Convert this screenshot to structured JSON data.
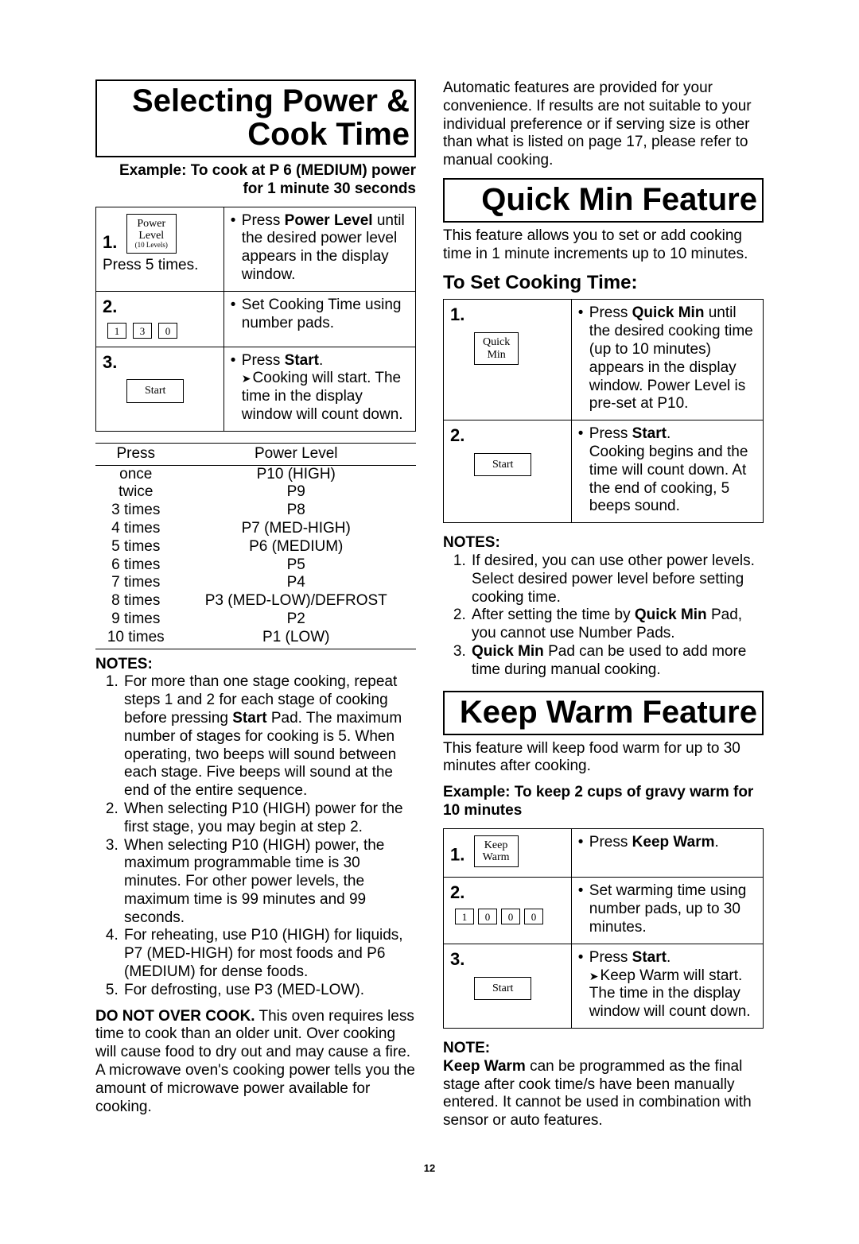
{
  "page_number": "12",
  "left": {
    "heading": "Selecting Power & Cook Time",
    "example_header": "Example: To cook at P 6 (MEDIUM) power for 1 minute 30 seconds",
    "steps": [
      {
        "num": "1.",
        "btn": {
          "l1": "Power",
          "l2": "Level",
          "l3": "(10 Levels)"
        },
        "caption": "Press 5 times.",
        "desc_pre": "Press ",
        "desc_bold": "Power Level",
        "desc_post": " until the desired power level appears in the display window."
      },
      {
        "num": "2.",
        "pads": [
          "1",
          "3",
          "0"
        ],
        "desc": "Set Cooking Time using number pads."
      },
      {
        "num": "3.",
        "btn": {
          "l1": "Start"
        },
        "desc_pre": "Press ",
        "desc_bold": "Start",
        "desc_post": ".",
        "arrow_text": "Cooking will start. The time in the display window will count down."
      }
    ],
    "power_table": {
      "headers": [
        "Press",
        "Power Level"
      ],
      "rows": [
        [
          "once",
          "P10 (HIGH)"
        ],
        [
          "twice",
          "P9"
        ],
        [
          "3 times",
          "P8"
        ],
        [
          "4 times",
          "P7 (MED-HIGH)"
        ],
        [
          "5 times",
          "P6 (MEDIUM)"
        ],
        [
          "6 times",
          "P5"
        ],
        [
          "7 times",
          "P4"
        ],
        [
          "8 times",
          "P3 (MED-LOW)/DEFROST"
        ],
        [
          "9 times",
          "P2"
        ],
        [
          "10 times",
          "P1 (LOW)"
        ]
      ]
    },
    "notes_label": "NOTES:",
    "notes": [
      "For more than one stage cooking, repeat steps 1 and 2 for each stage of cooking before pressing <b>Start</b> Pad. The maximum number of stages for cooking is 5. When operating, two beeps will sound between each stage. Five beeps will sound at the end of the entire sequence.",
      "When selecting P10 (HIGH) power for the first stage, you may begin at step 2.",
      "When selecting P10 (HIGH) power, the maximum programmable time is 30 minutes. For other power levels, the maximum time is 99 minutes and 99 seconds.",
      "For reheating, use P10 (HIGH) for liquids, P7 (MED-HIGH) for most foods and P6 (MEDIUM) for dense foods.",
      "For defrosting, use P3 (MED-LOW)."
    ],
    "warning": "<b>DO NOT OVER COOK.</b> This oven requires less time to cook than an older unit. Over cooking will cause food to dry out and may cause a fire. A microwave oven's cooking power tells you the amount of microwave power available for cooking."
  },
  "right": {
    "intro": "Automatic features are provided for your convenience. If results are not suitable to your individual preference or if serving size is other than what is listed on page 17, please refer to manual cooking.",
    "quick_heading": "Quick Min Feature",
    "quick_intro": "This feature allows you to set or add cooking time in 1 minute increments up to 10 minutes.",
    "set_cook_heading": "To Set Cooking Time:",
    "quick_steps": [
      {
        "num": "1.",
        "btn": {
          "l1": "Quick",
          "l2": "Min"
        },
        "desc_pre": "Press ",
        "desc_bold": "Quick Min",
        "desc_post": " until the desired cooking time (up to 10 minutes) appears in the display window. Power Level is pre-set at P10."
      },
      {
        "num": "2.",
        "btn": {
          "l1": "Start"
        },
        "desc_pre": "Press ",
        "desc_bold": "Start",
        "desc_post": ".",
        "extra": "Cooking begins and the time will count down. At the end of cooking, 5 beeps sound."
      }
    ],
    "quick_notes_label": "NOTES:",
    "quick_notes": [
      "If desired, you can use other power levels. Select desired power level before setting cooking time.",
      "After setting the time by <b>Quick Min</b> Pad, you cannot use Number Pads.",
      "<b>Quick Min</b> Pad can be used to add more time during manual cooking."
    ],
    "warm_heading": "Keep Warm Feature",
    "warm_intro": "This feature will keep food warm for up to 30 minutes after cooking.",
    "warm_example": "Example: To keep 2 cups of gravy warm for 10 minutes",
    "warm_steps": [
      {
        "num": "1.",
        "btn": {
          "l1": "Keep",
          "l2": "Warm"
        },
        "desc_pre": "Press ",
        "desc_bold": "Keep Warm",
        "desc_post": "."
      },
      {
        "num": "2.",
        "pads": [
          "1",
          "0",
          "0",
          "0"
        ],
        "desc": "Set warming time using number pads, up to 30 minutes."
      },
      {
        "num": "3.",
        "btn": {
          "l1": "Start"
        },
        "desc_pre": "Press ",
        "desc_bold": "Start",
        "desc_post": ".",
        "arrow_text": "Keep Warm will start. The time in the display window will count down."
      }
    ],
    "warm_note_label": "NOTE:",
    "warm_note": "<b>Keep Warm</b> can be programmed as the final stage after cook time/s have been manually entered. It cannot be used in combination with sensor or auto features."
  }
}
